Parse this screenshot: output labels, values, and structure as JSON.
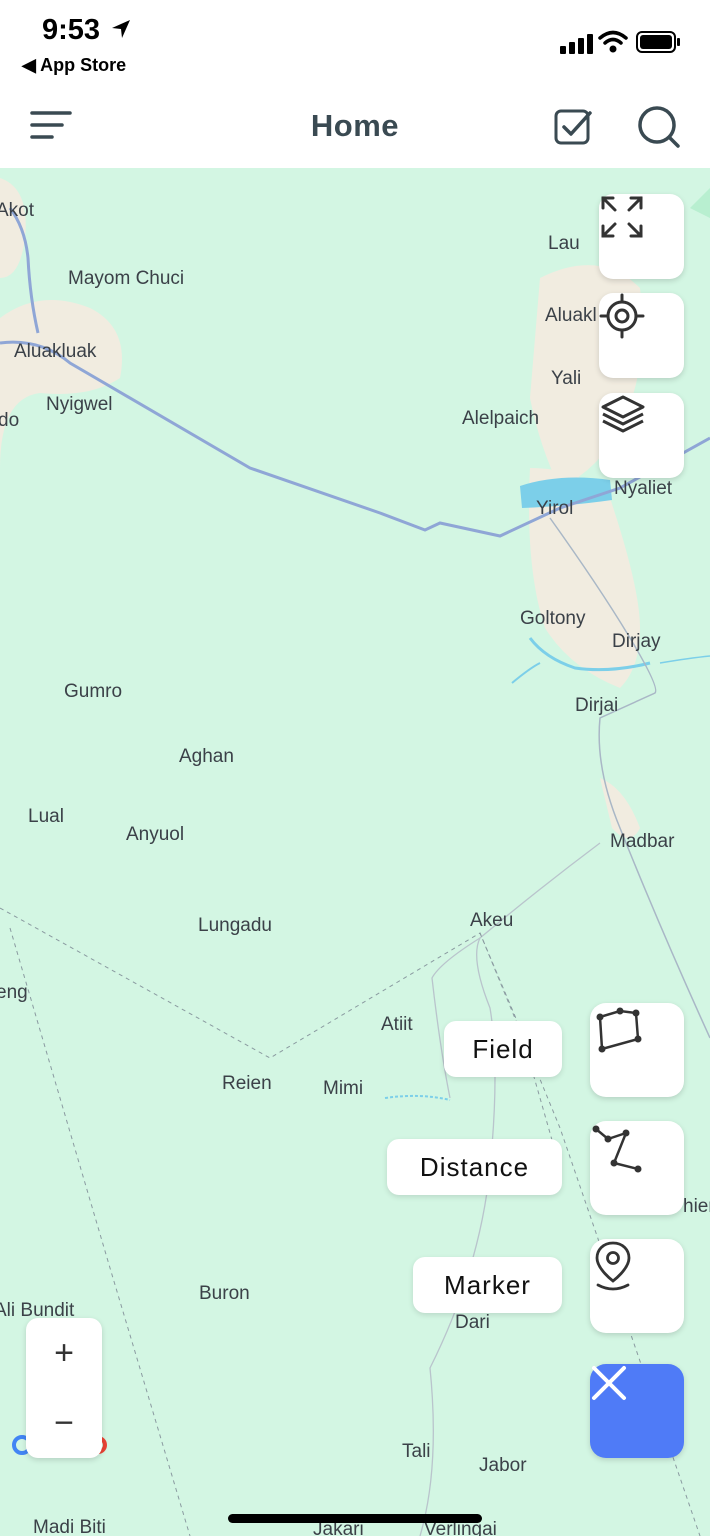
{
  "status": {
    "time": "9:53",
    "back_label": "◀ App Store"
  },
  "header": {
    "title": "Home"
  },
  "icons": {
    "menu": "menu-icon",
    "checklist": "checkbox-icon",
    "search": "search-icon",
    "fullscreen": "expand-icon",
    "locate": "target-icon",
    "layers": "layers-icon",
    "field": "polygon-icon",
    "distance": "path-icon",
    "marker": "pin-icon",
    "close": "close-icon"
  },
  "actions": {
    "field_label": "Field",
    "distance_label": "Distance",
    "marker_label": "Marker"
  },
  "zoom": {
    "in": "+",
    "out": "−"
  },
  "colors": {
    "map_bg": "#d3f6e3",
    "accent": "#4f7bf7",
    "water": "#7ccfe9",
    "town": "#f1ece0"
  },
  "places": {
    "akot": "Akot",
    "lau": "Lau",
    "mayom_chuci": "Mayom Chuci",
    "aluakl": "Aluakl",
    "aluakluak": "Aluakluak",
    "yali": "Yali",
    "nyigwel": "Nyigwel",
    "do": "do",
    "alelpaich": "Alelpaich",
    "nyaliet": "Nyaliet",
    "yirol": "Yirol",
    "goltony": "Goltony",
    "dirjay": "Dirjay",
    "gumro": "Gumro",
    "dirjai": "Dirjai",
    "aghan": "Aghan",
    "lual": "Lual",
    "anyuol": "Anyuol",
    "madbar": "Madbar",
    "akeu": "Akeu",
    "lungadu": "Lungadu",
    "eng": "eng",
    "atiit": "Atiit",
    "reien": "Reien",
    "mimi": "Mimi",
    "hier": "hier",
    "buron": "Buron",
    "ali_bundit": "Ali Bundit",
    "dari": "Dari",
    "tali": "Tali",
    "jabor": "Jabor",
    "madi_biti": "Madi Biti",
    "jakari": "Jakari",
    "verlingai": "Verlingai"
  }
}
